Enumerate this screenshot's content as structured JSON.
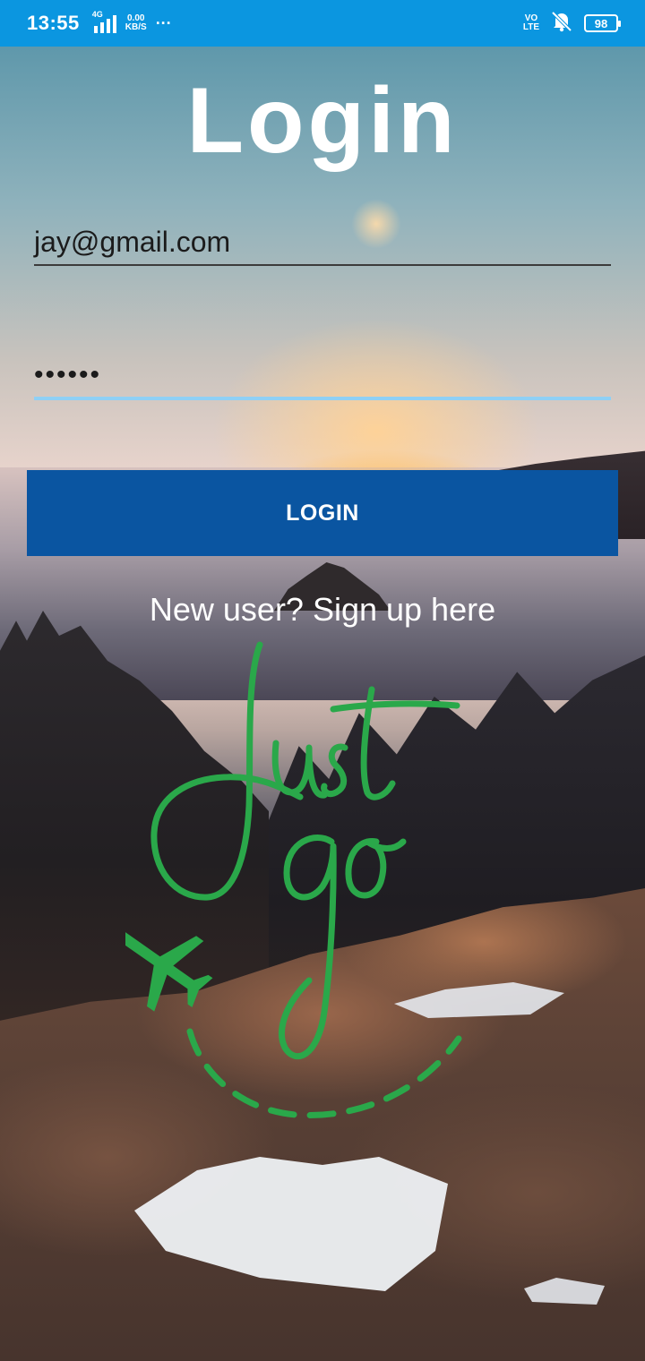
{
  "status_bar": {
    "time": "13:55",
    "network": "4G",
    "speed_value": "0.00",
    "speed_unit": "KB/S",
    "more": "···",
    "volte_top": "VO",
    "volte_bottom": "LTE",
    "battery": "98"
  },
  "page": {
    "title": "Login",
    "email_value": "jay@gmail.com",
    "password_value": "••••••",
    "login_button": "LOGIN",
    "signup_link": "New user? Sign up here"
  },
  "logo": {
    "text_line1": "Just",
    "text_line2": "go",
    "color": "#2aa84a",
    "icon": "airplane-icon"
  },
  "colors": {
    "status_bar": "#0b96e0",
    "button": "#0a55a1",
    "focus_underline": "#8fd0f5"
  }
}
